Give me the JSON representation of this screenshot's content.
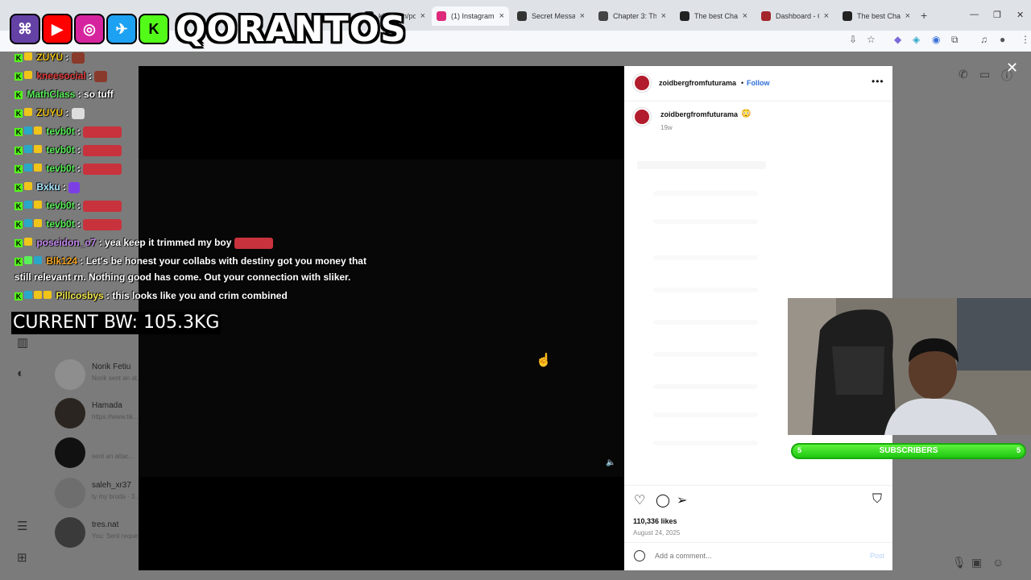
{
  "browser": {
    "tabs": [
      {
        "label": "kick.com/pop...",
        "color": "#1f1f1f"
      },
      {
        "label": "(1) Instagram -",
        "color": "#dd2a7b"
      },
      {
        "label": "Secret Messag",
        "color": "#333333"
      },
      {
        "label": "Chapter 3: The",
        "color": "#444444"
      },
      {
        "label": "The best Chat",
        "color": "#222222"
      },
      {
        "label": "Dashboard - C",
        "color": "#a3262b"
      },
      {
        "label": "The best Chat",
        "color": "#222222"
      }
    ],
    "new_tab": "+",
    "win_min": "—",
    "win_max": "❐",
    "win_close": "✕"
  },
  "overlay": {
    "channel_name": "QORANTOS",
    "platforms": [
      "twitch",
      "youtube",
      "instagram",
      "twitter",
      "kick"
    ],
    "bodyweight": "CURRENT BW: 105.3KG",
    "subs": {
      "left": "5",
      "label": "SUBSCRIBERS",
      "right": "5"
    }
  },
  "chat": [
    {
      "user": "ZUYU",
      "text": "",
      "color": "#f0c419"
    },
    {
      "user": "kneesocial",
      "text": "",
      "color": "#e23b3b"
    },
    {
      "user": "MathClass",
      "text": "so tuff",
      "color": "#5af05a"
    },
    {
      "user": "ZUYU",
      "text": "",
      "color": "#f0c419"
    },
    {
      "user": "tevb0t",
      "text": "",
      "color": "#5af05a"
    },
    {
      "user": "tevb0t",
      "text": "",
      "color": "#5af05a"
    },
    {
      "user": "tevb0t",
      "text": "",
      "color": "#5af05a"
    },
    {
      "user": "Bxku",
      "text": "",
      "color": "#a7e7ff"
    },
    {
      "user": "tevb0t",
      "text": "",
      "color": "#5af05a"
    },
    {
      "user": "tevb0t",
      "text": "",
      "color": "#5af05a"
    },
    {
      "user": "poseidon_o7",
      "text": "yea keep it trimmed my boy",
      "color": "#c58af0"
    },
    {
      "user": "Blk124",
      "text": "Let's be honest your collabs with destiny got you money that",
      "text2": "still relevant rn. Nothing good has come. Out your connection with sliker.",
      "color": "#f5a623"
    },
    {
      "user": "Pillcosbys",
      "text": "this looks like you and crim combined",
      "color": "#f0e64a"
    }
  ],
  "background": {
    "dm_rows": [
      {
        "name": "Norik Fetiu",
        "preview": "Norik sent an at..."
      },
      {
        "name": "Hamada",
        "preview": "https://www.tik..."
      },
      {
        "name": "",
        "preview": "sent an attac..."
      },
      {
        "name": "saleh_xr37",
        "preview": "ty my broda · 3..."
      },
      {
        "name": "tres.nat",
        "preview": "You: Sent reque..."
      }
    ]
  },
  "post": {
    "username": "zoidbergfromfuturama",
    "follow_label": "Follow",
    "dot": "•",
    "more": "•••",
    "caption_user": "zoidbergfromfuturama",
    "caption_emoji": "😳",
    "time_ago": "19w",
    "likes": "110,336 likes",
    "date": "August 24, 2025",
    "comment_placeholder": "Add a comment...",
    "post_label": "Post"
  },
  "icons": {
    "close": "✕",
    "mute": "🔈",
    "cursor": "☝"
  }
}
